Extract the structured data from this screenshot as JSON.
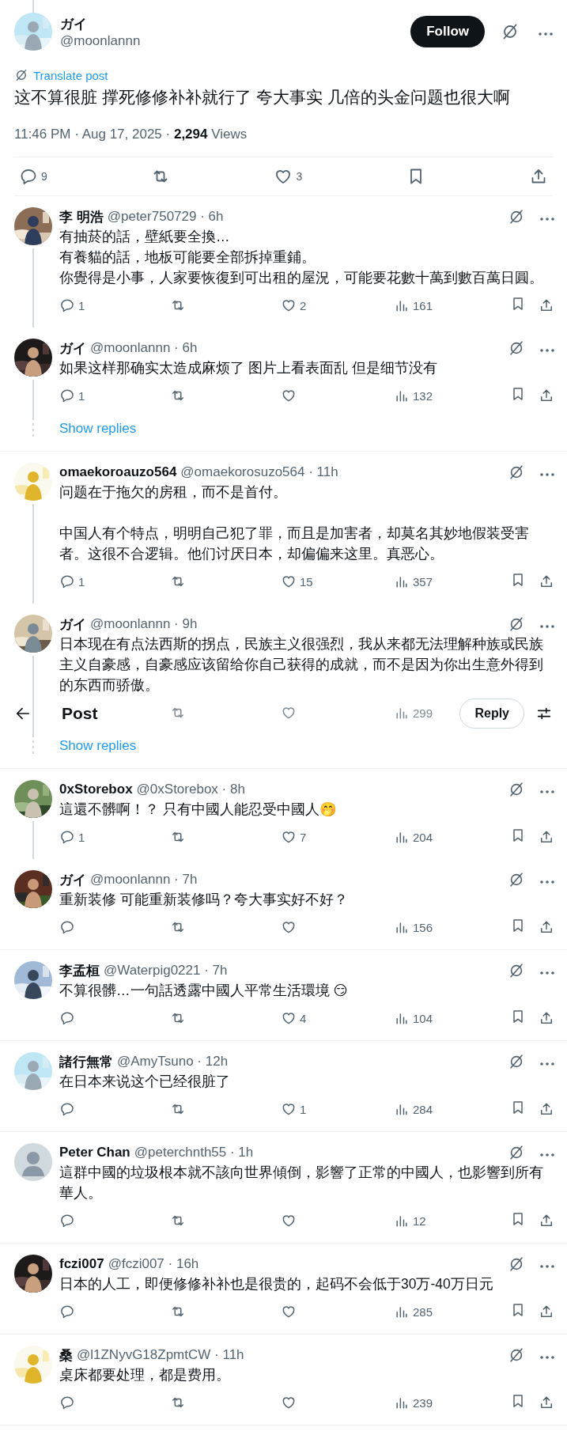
{
  "post": {
    "author": {
      "name": "ガイ",
      "handle": "@moonlannn",
      "avatar": {
        "kind": "picture"
      }
    },
    "follow_button": "Follow",
    "translate": "Translate post",
    "text": "这不算很脏 撑死修修补补就行了 夸大事实 几倍的头金问题也很大啊",
    "time": "11:46 PM · Aug 17, 2025 · ",
    "views_count": "2,294",
    "views_label": "Views",
    "actions": {
      "replies": "9",
      "likes": "3"
    }
  },
  "header": {
    "title": "Post",
    "reply_button": "Reply"
  },
  "threads": [
    {
      "replies": [
        {
          "name": "李 明浩",
          "handle": "@peter750729 · 6h",
          "avatar": {
            "kind": "picture"
          },
          "paragraphs": [
            [
              "有抽菸的話，壁紙要全換…",
              "有養貓的話，地板可能要全部拆掉重鋪。",
              "你覺得是小事，人家要恢復到可出租的屋況，可能要花數十萬到數百萬日圓。"
            ]
          ],
          "actions": {
            "replies": "1",
            "likes": "2",
            "views": "161"
          },
          "under_header": false
        },
        {
          "name": "ガイ",
          "handle": "@moonlannn · 6h",
          "avatar": {
            "kind": "picture"
          },
          "text": "如果这样那确实太造成麻烦了 图片上看表面乱 但是细节没有",
          "actions": {
            "replies": "1",
            "views": "132"
          },
          "under_header": false
        }
      ],
      "show_replies": "Show replies"
    },
    {
      "replies": [
        {
          "name": "omaekoroauzo564",
          "handle": "@omaekorosuzo564 · 11h",
          "avatar": {
            "kind": "picture"
          },
          "paragraphs": [
            [
              "问题在于拖欠的房租，而不是首付。"
            ],
            [
              "中国人有个特点，明明自己犯了罪，而且是加害者，却莫名其妙地假装受害者。这很不合逻辑。他们讨厌日本，却偏偏来这里。真恶心。"
            ]
          ],
          "actions": {
            "replies": "1",
            "likes": "15",
            "views": "357"
          },
          "under_header": false
        },
        {
          "name": "ガイ",
          "handle": "@moonlannn · 9h",
          "avatar": {
            "kind": "picture"
          },
          "text": "日本现在有点法西斯的拐点，民族主义很强烈，我从来都无法理解种族或民族主义自豪感，自豪感应该留给你自己获得的成就，而不是因为你出生意外得到的东西而骄傲。",
          "actions": {
            "views": "299"
          },
          "under_header": true
        }
      ],
      "show_replies": "Show replies"
    },
    {
      "replies": [
        {
          "name": "0xStorebox",
          "handle": "@0xStorebox · 8h",
          "avatar": {
            "kind": "picture"
          },
          "text": "這還不髒啊！？ 只有中國人能忍受中國人🤭",
          "actions": {
            "replies": "1",
            "likes": "7",
            "views": "204"
          },
          "under_header": false
        },
        {
          "name": "ガイ",
          "handle": "@moonlannn · 7h",
          "avatar": {
            "kind": "picture"
          },
          "text": "重新装修 可能重新装修吗？夸大事实好不好？",
          "actions": {
            "views": "156"
          },
          "under_header": false
        }
      ]
    },
    {
      "replies": [
        {
          "name": "李孟桓",
          "handle": "@Waterpig0221 · 7h",
          "avatar": {
            "kind": "picture"
          },
          "text": "不算很髒…一句話透露中國人平常生活環境 😏",
          "actions": {
            "likes": "4",
            "views": "104"
          },
          "under_header": false
        }
      ]
    },
    {
      "replies": [
        {
          "name": "諸行無常",
          "handle": "@AmyTsuno · 12h",
          "avatar": {
            "kind": "picture"
          },
          "text": "在日本来说这个已经很脏了",
          "actions": {
            "likes": "1",
            "views": "284"
          },
          "under_header": false
        }
      ]
    },
    {
      "replies": [
        {
          "name": "Peter Chan",
          "handle": "@peterchnth55 · 1h",
          "avatar": {
            "kind": "default"
          },
          "text": "這群中國的垃圾根本就不該向世界傾倒，影響了正常的中國人，也影響到所有華人。",
          "actions": {
            "views": "12"
          },
          "under_header": false
        }
      ]
    },
    {
      "replies": [
        {
          "name": "fczi007",
          "handle": "@fczi007 · 16h",
          "avatar": {
            "kind": "picture"
          },
          "text": "日本的人工，即便修修补补也是很贵的，起码不会低于30万-40万日元",
          "actions": {
            "views": "285"
          },
          "under_header": false
        }
      ]
    },
    {
      "replies": [
        {
          "name": "桑",
          "handle": "@l1ZNyvG18ZpmtCW · 11h",
          "avatar": {
            "kind": "picture"
          },
          "text": "桌床都要处理，都是费用。",
          "actions": {
            "views": "239"
          },
          "under_header": false
        }
      ]
    }
  ]
}
